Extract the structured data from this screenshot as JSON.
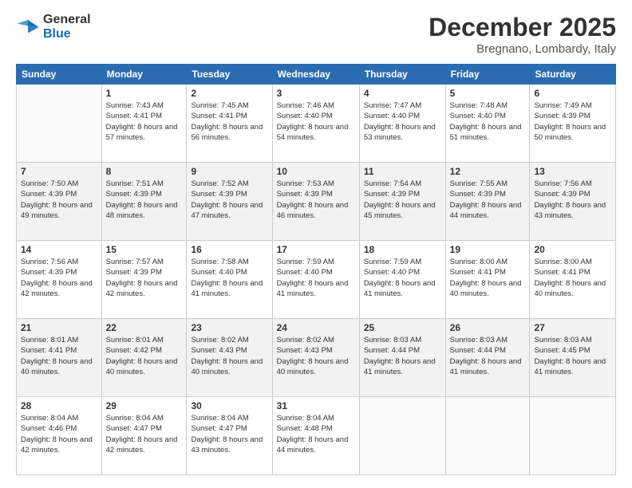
{
  "logo": {
    "line1": "General",
    "line2": "Blue"
  },
  "title": "December 2025",
  "location": "Bregnano, Lombardy, Italy",
  "weekdays": [
    "Sunday",
    "Monday",
    "Tuesday",
    "Wednesday",
    "Thursday",
    "Friday",
    "Saturday"
  ],
  "weeks": [
    [
      {
        "day": "",
        "sunrise": "",
        "sunset": "",
        "daylight": ""
      },
      {
        "day": "1",
        "sunrise": "Sunrise: 7:43 AM",
        "sunset": "Sunset: 4:41 PM",
        "daylight": "Daylight: 8 hours and 57 minutes."
      },
      {
        "day": "2",
        "sunrise": "Sunrise: 7:45 AM",
        "sunset": "Sunset: 4:41 PM",
        "daylight": "Daylight: 8 hours and 56 minutes."
      },
      {
        "day": "3",
        "sunrise": "Sunrise: 7:46 AM",
        "sunset": "Sunset: 4:40 PM",
        "daylight": "Daylight: 8 hours and 54 minutes."
      },
      {
        "day": "4",
        "sunrise": "Sunrise: 7:47 AM",
        "sunset": "Sunset: 4:40 PM",
        "daylight": "Daylight: 8 hours and 53 minutes."
      },
      {
        "day": "5",
        "sunrise": "Sunrise: 7:48 AM",
        "sunset": "Sunset: 4:40 PM",
        "daylight": "Daylight: 8 hours and 51 minutes."
      },
      {
        "day": "6",
        "sunrise": "Sunrise: 7:49 AM",
        "sunset": "Sunset: 4:39 PM",
        "daylight": "Daylight: 8 hours and 50 minutes."
      }
    ],
    [
      {
        "day": "7",
        "sunrise": "Sunrise: 7:50 AM",
        "sunset": "Sunset: 4:39 PM",
        "daylight": "Daylight: 8 hours and 49 minutes."
      },
      {
        "day": "8",
        "sunrise": "Sunrise: 7:51 AM",
        "sunset": "Sunset: 4:39 PM",
        "daylight": "Daylight: 8 hours and 48 minutes."
      },
      {
        "day": "9",
        "sunrise": "Sunrise: 7:52 AM",
        "sunset": "Sunset: 4:39 PM",
        "daylight": "Daylight: 8 hours and 47 minutes."
      },
      {
        "day": "10",
        "sunrise": "Sunrise: 7:53 AM",
        "sunset": "Sunset: 4:39 PM",
        "daylight": "Daylight: 8 hours and 46 minutes."
      },
      {
        "day": "11",
        "sunrise": "Sunrise: 7:54 AM",
        "sunset": "Sunset: 4:39 PM",
        "daylight": "Daylight: 8 hours and 45 minutes."
      },
      {
        "day": "12",
        "sunrise": "Sunrise: 7:55 AM",
        "sunset": "Sunset: 4:39 PM",
        "daylight": "Daylight: 8 hours and 44 minutes."
      },
      {
        "day": "13",
        "sunrise": "Sunrise: 7:56 AM",
        "sunset": "Sunset: 4:39 PM",
        "daylight": "Daylight: 8 hours and 43 minutes."
      }
    ],
    [
      {
        "day": "14",
        "sunrise": "Sunrise: 7:56 AM",
        "sunset": "Sunset: 4:39 PM",
        "daylight": "Daylight: 8 hours and 42 minutes."
      },
      {
        "day": "15",
        "sunrise": "Sunrise: 7:57 AM",
        "sunset": "Sunset: 4:39 PM",
        "daylight": "Daylight: 8 hours and 42 minutes."
      },
      {
        "day": "16",
        "sunrise": "Sunrise: 7:58 AM",
        "sunset": "Sunset: 4:40 PM",
        "daylight": "Daylight: 8 hours and 41 minutes."
      },
      {
        "day": "17",
        "sunrise": "Sunrise: 7:59 AM",
        "sunset": "Sunset: 4:40 PM",
        "daylight": "Daylight: 8 hours and 41 minutes."
      },
      {
        "day": "18",
        "sunrise": "Sunrise: 7:59 AM",
        "sunset": "Sunset: 4:40 PM",
        "daylight": "Daylight: 8 hours and 41 minutes."
      },
      {
        "day": "19",
        "sunrise": "Sunrise: 8:00 AM",
        "sunset": "Sunset: 4:41 PM",
        "daylight": "Daylight: 8 hours and 40 minutes."
      },
      {
        "day": "20",
        "sunrise": "Sunrise: 8:00 AM",
        "sunset": "Sunset: 4:41 PM",
        "daylight": "Daylight: 8 hours and 40 minutes."
      }
    ],
    [
      {
        "day": "21",
        "sunrise": "Sunrise: 8:01 AM",
        "sunset": "Sunset: 4:41 PM",
        "daylight": "Daylight: 8 hours and 40 minutes."
      },
      {
        "day": "22",
        "sunrise": "Sunrise: 8:01 AM",
        "sunset": "Sunset: 4:42 PM",
        "daylight": "Daylight: 8 hours and 40 minutes."
      },
      {
        "day": "23",
        "sunrise": "Sunrise: 8:02 AM",
        "sunset": "Sunset: 4:43 PM",
        "daylight": "Daylight: 8 hours and 40 minutes."
      },
      {
        "day": "24",
        "sunrise": "Sunrise: 8:02 AM",
        "sunset": "Sunset: 4:43 PM",
        "daylight": "Daylight: 8 hours and 40 minutes."
      },
      {
        "day": "25",
        "sunrise": "Sunrise: 8:03 AM",
        "sunset": "Sunset: 4:44 PM",
        "daylight": "Daylight: 8 hours and 41 minutes."
      },
      {
        "day": "26",
        "sunrise": "Sunrise: 8:03 AM",
        "sunset": "Sunset: 4:44 PM",
        "daylight": "Daylight: 8 hours and 41 minutes."
      },
      {
        "day": "27",
        "sunrise": "Sunrise: 8:03 AM",
        "sunset": "Sunset: 4:45 PM",
        "daylight": "Daylight: 8 hours and 41 minutes."
      }
    ],
    [
      {
        "day": "28",
        "sunrise": "Sunrise: 8:04 AM",
        "sunset": "Sunset: 4:46 PM",
        "daylight": "Daylight: 8 hours and 42 minutes."
      },
      {
        "day": "29",
        "sunrise": "Sunrise: 8:04 AM",
        "sunset": "Sunset: 4:47 PM",
        "daylight": "Daylight: 8 hours and 42 minutes."
      },
      {
        "day": "30",
        "sunrise": "Sunrise: 8:04 AM",
        "sunset": "Sunset: 4:47 PM",
        "daylight": "Daylight: 8 hours and 43 minutes."
      },
      {
        "day": "31",
        "sunrise": "Sunrise: 8:04 AM",
        "sunset": "Sunset: 4:48 PM",
        "daylight": "Daylight: 8 hours and 44 minutes."
      },
      {
        "day": "",
        "sunrise": "",
        "sunset": "",
        "daylight": ""
      },
      {
        "day": "",
        "sunrise": "",
        "sunset": "",
        "daylight": ""
      },
      {
        "day": "",
        "sunrise": "",
        "sunset": "",
        "daylight": ""
      }
    ]
  ]
}
